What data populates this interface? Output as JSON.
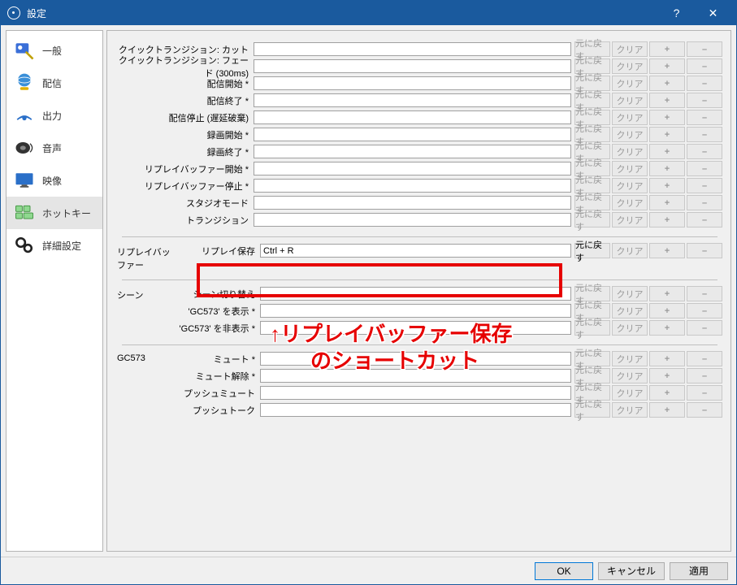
{
  "window": {
    "title": "設定"
  },
  "sidebar": {
    "items": [
      {
        "label": "一般"
      },
      {
        "label": "配信"
      },
      {
        "label": "出力"
      },
      {
        "label": "音声"
      },
      {
        "label": "映像"
      },
      {
        "label": "ホットキー"
      },
      {
        "label": "詳細設定"
      }
    ]
  },
  "buttons": {
    "revert": "元に戻す",
    "clear": "クリア",
    "plus": "+",
    "minus": "–"
  },
  "general_rows": [
    {
      "label": "クイックトランジション: カット",
      "value": ""
    },
    {
      "label": "クイックトランジション: フェード (300ms)",
      "value": ""
    },
    {
      "label": "配信開始 *",
      "value": ""
    },
    {
      "label": "配信終了 *",
      "value": ""
    },
    {
      "label": "配信停止 (遅延破棄)",
      "value": ""
    },
    {
      "label": "録画開始 *",
      "value": ""
    },
    {
      "label": "録画終了 *",
      "value": ""
    },
    {
      "label": "リプレイバッファー開始 *",
      "value": ""
    },
    {
      "label": "リプレイバッファー停止 *",
      "value": ""
    },
    {
      "label": "スタジオモード",
      "value": ""
    },
    {
      "label": "トランジション",
      "value": ""
    }
  ],
  "sections": [
    {
      "title": "リプレイバッファー",
      "rows": [
        {
          "label": "リプレイ保存",
          "value": "Ctrl + R",
          "active_revert": true,
          "highlight": true
        }
      ]
    },
    {
      "title": "シーン",
      "rows": [
        {
          "label": "シーン切り替え",
          "value": ""
        },
        {
          "label": "'GC573' を表示 *",
          "value": ""
        },
        {
          "label": "'GC573' を非表示 *",
          "value": ""
        }
      ]
    },
    {
      "title": "GC573",
      "rows": [
        {
          "label": "ミュート *",
          "value": ""
        },
        {
          "label": "ミュート解除 *",
          "value": ""
        },
        {
          "label": "プッシュミュート",
          "value": ""
        },
        {
          "label": "プッシュトーク",
          "value": ""
        }
      ]
    }
  ],
  "annotation": {
    "line1": "↑リプレイバッファー保存",
    "line2": "のショートカット"
  },
  "footer": {
    "ok": "OK",
    "cancel": "キャンセル",
    "apply": "適用"
  }
}
